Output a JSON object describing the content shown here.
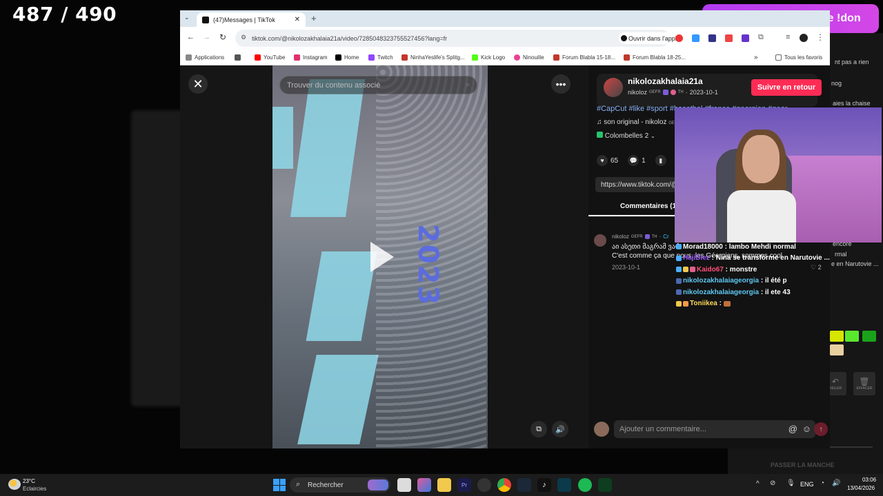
{
  "stream": {
    "counter": "487 / 490",
    "banner": "Vidéo, vocal ou alerte !don"
  },
  "browser": {
    "tab_title": "(47)Messages | TikTok",
    "url": "tiktok.com/@nikolozakhalaia21a/video/7285048323755527456?lang=fr",
    "open_in_app": "Ouvrir dans l'appli",
    "bookmarks": [
      {
        "label": "Applications",
        "color": "#888"
      },
      {
        "label": "YouTube",
        "color": "#ff0000"
      },
      {
        "label": "Instagram",
        "color": "#e1306c"
      },
      {
        "label": "Home",
        "color": "#000000"
      },
      {
        "label": "Twitch",
        "color": "#9146ff"
      },
      {
        "label": "NinhaYeslife's Splitg...",
        "color": "#c0392b"
      },
      {
        "label": "Kick Logo",
        "color": "#53fc18"
      },
      {
        "label": "Ninouille",
        "color": "#e84393"
      },
      {
        "label": "Forum Blabla 15-18...",
        "color": "#c0392b"
      },
      {
        "label": "Forum Blabla 18-25...",
        "color": "#c0392b"
      }
    ],
    "all_favorites": "Tous les favoris"
  },
  "tiktok": {
    "search_placeholder": "Trouver du contenu associé",
    "video_text": "2023",
    "username": "nikolozakhalaia21a",
    "nickname": "nikoloz",
    "gefr": "GEFR",
    "th": "TH",
    "date": "2023-10-1",
    "follow_label": "Suivre en retour",
    "hashtags": "#CapCut #like #sport #basetbal #france #georgian #geor",
    "sound": "son original - nikoloz",
    "sound_tag": "GE",
    "collection": "Colombelles",
    "collection_count": "2",
    "likes": "65",
    "comments": "1",
    "link": "https://www.tiktok.com/@",
    "comments_tab": "Commentaires (1)",
    "comment": {
      "author": "nikoloz",
      "gefr": "GEFR",
      "th": "TH",
      "tag": "Cr",
      "line1": "აი ასეთი მაგრამ ვარ",
      "line2": "C'est comme ça que nous, les Géorgiens, sommes cool",
      "date": "2023-10-1",
      "likes": "2"
    },
    "comment_placeholder": "Ajouter un commentaire..."
  },
  "side_panel": {
    "items": [
      "nt pas a rien",
      "nog",
      "aies la chaise",
      "encore",
      "rmal",
      "e en Narutovie ...",
      "INULER",
      "EFFACER",
      "PASSER LA MANCHE"
    ]
  },
  "chat": [
    {
      "user": "Morad18000",
      "message": "lambo Mehdi normal",
      "color": "#ffffff"
    },
    {
      "user": "HajiDiez",
      "message": "Nina se transforme en Narutovie ...",
      "color": "#9b59ff"
    },
    {
      "user": "Kaido67",
      "message": "monstre",
      "color": "#ff4f7b"
    },
    {
      "user": "nikolozakhalaiageorgia",
      "message": "il été p",
      "color": "#5ec8f2"
    },
    {
      "user": "nikolozakhalaiageorgia",
      "message": "il ete 43",
      "color": "#5ec8f2"
    },
    {
      "user": "Toniikea",
      "message": "",
      "color": "#ffd95a"
    }
  ],
  "taskbar": {
    "weather_temp": "23°C",
    "weather_desc": "Eclaircies",
    "search": "Rechercher",
    "lang": "ENG",
    "time": "03:06",
    "date": "13/04/2026"
  },
  "colors": {
    "follow": "#fe2c55",
    "banner": "#c03ff0",
    "swatches": [
      "#d6e600",
      "#5be62e",
      "#1aa31a",
      "#e8cfa0"
    ]
  }
}
